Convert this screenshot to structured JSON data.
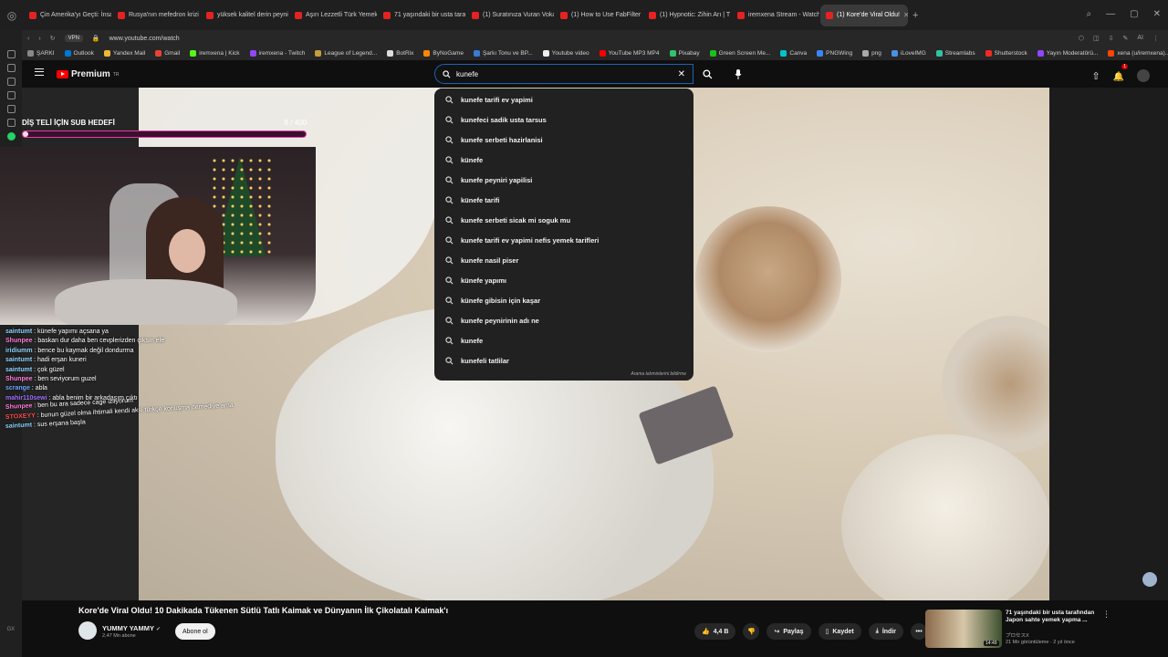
{
  "browser": {
    "tabs": [
      {
        "label": "Çin Amerika'yı Geçti: İnsan"
      },
      {
        "label": "Rusya'nın mefedron krizi"
      },
      {
        "label": "yüksek kalitel derin peyni"
      },
      {
        "label": "Aşırı Lezzetli Türk Yemek"
      },
      {
        "label": "71 yaşındaki bir usta taraf"
      },
      {
        "label": "(1) Suratınıza Vuran Vokal"
      },
      {
        "label": "(1) How to Use FabFilter P"
      },
      {
        "label": "(1) Hypnotic: Zihin Arı | T"
      },
      {
        "label": "iremxena Stream - Watch"
      },
      {
        "label": "(1) Kore'de Viral Oldu!"
      }
    ],
    "vpn_badge": "VPN",
    "url": "www.youtube.com/watch",
    "ai_label": "AI",
    "bookmarks": [
      {
        "label": "ŞARKI",
        "color": "#888888"
      },
      {
        "label": "Outlook",
        "color": "#0078d4"
      },
      {
        "label": "Yandex Mail",
        "color": "#f2b632"
      },
      {
        "label": "Gmail",
        "color": "#ea4335"
      },
      {
        "label": "iremxena | Kick",
        "color": "#53fc18"
      },
      {
        "label": "iremxena - Twitch",
        "color": "#9146ff"
      },
      {
        "label": "League of Legend...",
        "color": "#c89b3c"
      },
      {
        "label": "BotRix",
        "color": "#dddddd"
      },
      {
        "label": "ByNoGame",
        "color": "#ff8800"
      },
      {
        "label": "Şarkı Tonu ve BP...",
        "color": "#3a7bd5"
      },
      {
        "label": "Youtube video",
        "color": "#eeeeee"
      },
      {
        "label": "YouTube MP3 MP4",
        "color": "#ff0000"
      },
      {
        "label": "Pixabay",
        "color": "#2ec66d"
      },
      {
        "label": "Green Screen Me...",
        "color": "#19c219"
      },
      {
        "label": "Canva",
        "color": "#00c4cc"
      },
      {
        "label": "PNGWing",
        "color": "#3a86ff"
      },
      {
        "label": "png",
        "color": "#aaaaaa"
      },
      {
        "label": "iLoveIMG",
        "color": "#4a90e2"
      },
      {
        "label": "Streamlabs",
        "color": "#31c3a2"
      },
      {
        "label": "Shutterstock",
        "color": "#ee2b24"
      },
      {
        "label": "Yayın Moderatörü...",
        "color": "#9146ff"
      },
      {
        "label": "xena (u/iremxena)...",
        "color": "#ff4500"
      }
    ]
  },
  "youtube": {
    "logo_text": "Premium",
    "logo_sup": "TR",
    "search": {
      "query": "kunefe",
      "suggestions": [
        "kunefe tarifi ev yapimi",
        "kunefeci sadik usta tarsus",
        "kunefe serbeti hazirlanisi",
        "künefe",
        "kunefe peyniri yapilisi",
        "künefe tarifi",
        "kunefe serbeti sicak mi soguk mu",
        "kunefe tarifi ev yapimi nefis yemek tarifleri",
        "kunefe nasil piser",
        "künefe yapımı",
        "künefe gibisin için kaşar",
        "kunefe peynirinin adı ne",
        "kunefe",
        "kunefeli tatlilar"
      ],
      "report_text": "Arama tahminlerini bildirme"
    },
    "notification_count": "1",
    "video": {
      "title": "Kore'de Viral Oldu! 10 Dakikada Tükenen Sütlü Tatlı Kaimak ve Dünyanın İlk Çikolatalı Kaimak'ı",
      "channel": "YUMMY YAMMY",
      "subscribers": "2,47 Mn abone",
      "subscribe_label": "Abone ol",
      "likes": "4,4 B",
      "share_label": "Paylaş",
      "save_label": "Kaydet",
      "download_label": "İndir"
    },
    "recommended": {
      "title": "71 yaşındaki bir usta tarafından Japon sahte yemek yapma ...",
      "channel": "プロセスX",
      "meta": "21 Mn görüntüleme · 2 yıl önce",
      "duration": "14:49"
    }
  },
  "overlay": {
    "goal_title": "DİŞ TELİ İÇİN SUB HEDEFİ",
    "goal_current": "8",
    "goal_total": "/ 400",
    "goal_fraction": 0.02,
    "chat": [
      {
        "user": "saintumt",
        "text": "künefe yapımı açsana ya",
        "color": "#8fd3ff"
      },
      {
        "user": "Shunpee",
        "text": "baskan dur daha ben cevplerizden çıksın efe",
        "color": "#ff7ad9"
      },
      {
        "user": "iridiumm",
        "text": "bence bu kaymak değil dondurma",
        "color": "#8fd3ff"
      },
      {
        "user": "saintumt",
        "text": "hadi erşan kuneri",
        "color": "#8fd3ff"
      },
      {
        "user": "saintumt",
        "text": "çok güzel",
        "color": "#8fd3ff"
      },
      {
        "user": "Shunpee",
        "text": "ben seviyorum guzel",
        "color": "#ff7ad9"
      },
      {
        "user": "scrange",
        "text": "abla",
        "color": "#6ea8ff"
      },
      {
        "user": "mahir110sewi",
        "text": "abla benim bir arkadaşım çıktı",
        "color": "#a070ff"
      },
      {
        "user": "Shunpee",
        "text": "ben bu ara sadece cage izliyorum",
        "color": "#ff7ad9"
      },
      {
        "user": "STOXEYY",
        "text": "bunun güzel olma ihtimali kendi aksi türkçe konuşma demediye ama",
        "color": "#ff5050"
      },
      {
        "user": "saintumt",
        "text": "sus erşana başla",
        "color": "#8fd3ff"
      }
    ]
  }
}
